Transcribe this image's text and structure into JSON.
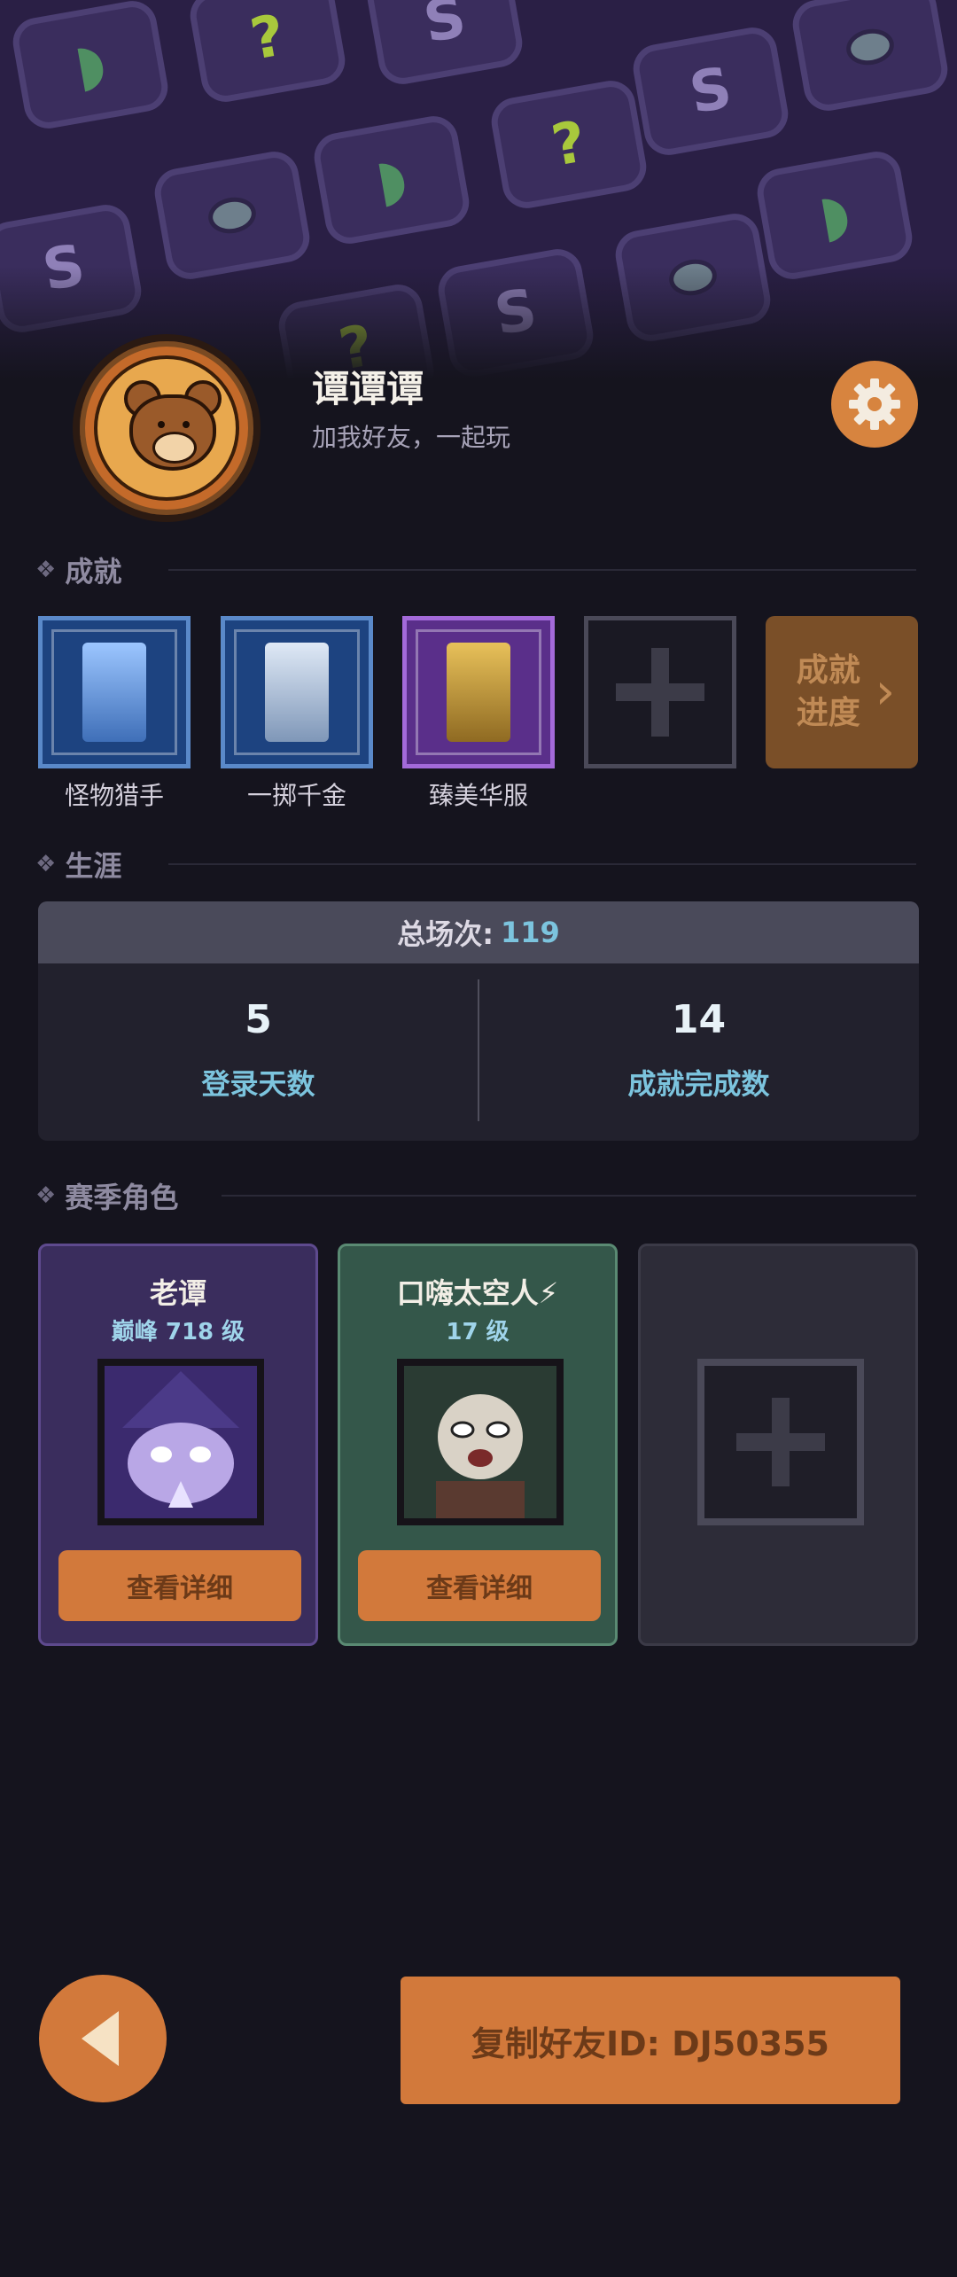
{
  "profile": {
    "name": "谭谭谭",
    "motto": "加我好友，一起玩",
    "avatar_icon": "bear-avatar"
  },
  "achievements": {
    "section_title": "成就",
    "items": [
      {
        "label": "怪物猎手",
        "rarity": "blue"
      },
      {
        "label": "一掷千金",
        "rarity": "blue"
      },
      {
        "label": "臻美华服",
        "rarity": "purple"
      }
    ],
    "progress_label_line1": "成就",
    "progress_label_line2": "进度"
  },
  "career": {
    "section_title": "生涯",
    "total_label": "总场次:",
    "total_value": "119",
    "login_days_value": "5",
    "login_days_label": "登录天数",
    "achievements_done_value": "14",
    "achievements_done_label": "成就完成数"
  },
  "season_heroes": {
    "section_title": "赛季角色",
    "cards": [
      {
        "name": "老谭",
        "level": "巅峰 718 级",
        "button": "查看详细"
      },
      {
        "name": "口嗨太空人⚡",
        "level": "17 级",
        "button": "查看详细"
      }
    ]
  },
  "footer": {
    "copy_button": "复制好友ID: DJ50355"
  },
  "colors": {
    "accent": "#d2793b",
    "background": "#15141e",
    "cyan_text": "#7cc4de"
  }
}
